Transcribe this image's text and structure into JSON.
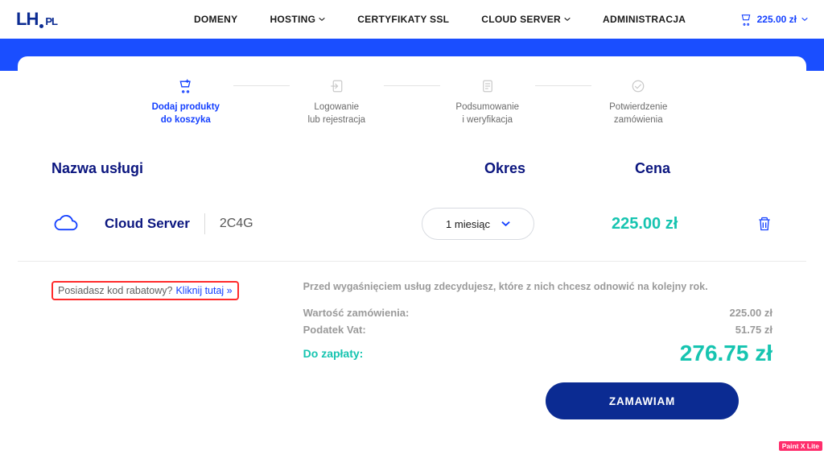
{
  "header": {
    "logo_main": "LH",
    "logo_suffix": "PL",
    "nav": [
      "DOMENY",
      "HOSTING",
      "CERTYFIKATY SSL",
      "CLOUD SERVER",
      "ADMINISTRACJA"
    ],
    "cart_amount": "225.00 zł"
  },
  "stepper": [
    {
      "line1": "Dodaj produkty",
      "line2": "do koszyka",
      "active": true
    },
    {
      "line1": "Logowanie",
      "line2": "lub rejestracja",
      "active": false
    },
    {
      "line1": "Podsumowanie",
      "line2": "i weryfikacja",
      "active": false
    },
    {
      "line1": "Potwierdzenie",
      "line2": "zamówienia",
      "active": false
    }
  ],
  "columns": {
    "service": "Nazwa usługi",
    "period": "Okres",
    "price": "Cena"
  },
  "item": {
    "name": "Cloud Server",
    "spec": "2C4G",
    "period": "1 miesiąc",
    "price": "225.00 zł"
  },
  "promo": {
    "question": "Posiadasz kod rabatowy?",
    "link": "Kliknij tutaj »"
  },
  "summary": {
    "note": "Przed wygaśnięciem usług zdecydujesz, które z nich chcesz odnowić na kolejny rok.",
    "value_label": "Wartość zamówienia:",
    "value_amount": "225.00 zł",
    "vat_label": "Podatek Vat:",
    "vat_amount": "51.75 zł",
    "total_label": "Do zapłaty:",
    "total_amount": "276.75 zł"
  },
  "order_btn": "ZAMAWIAM",
  "badge": "Paint X Lite"
}
